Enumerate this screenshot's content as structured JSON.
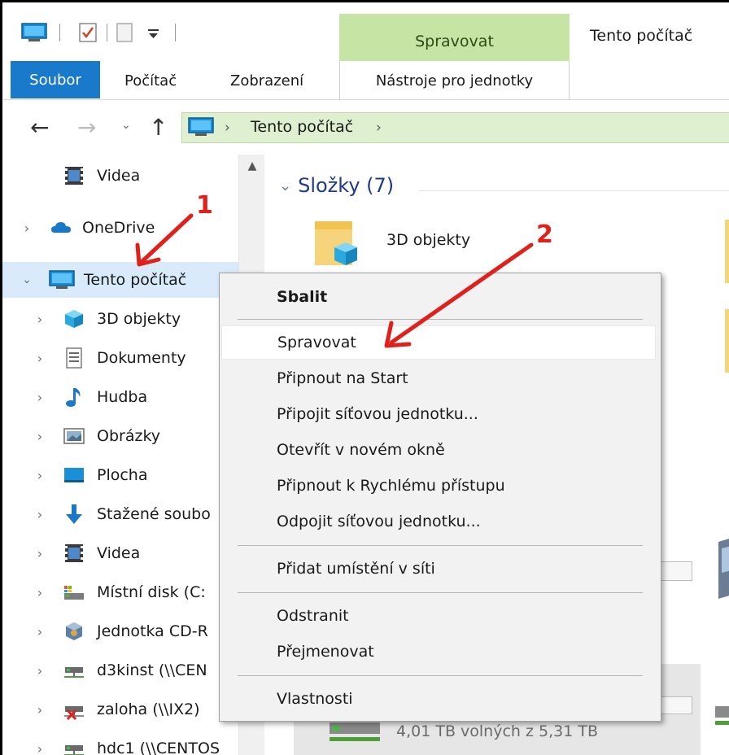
{
  "window": {
    "title": "Tento počítač"
  },
  "ribbon": {
    "context_group": "Spravovat",
    "tabs": [
      {
        "label": "Soubor"
      },
      {
        "label": "Počítač"
      },
      {
        "label": "Zobrazení"
      },
      {
        "label": "Nástroje pro jednotky"
      }
    ]
  },
  "toolbar": {
    "icons": [
      "computer-icon",
      "properties-check-icon",
      "new-folder-icon",
      "customize-dropdown-icon"
    ]
  },
  "address": {
    "back_icon": "arrow-left-icon",
    "forward_icon": "arrow-right-icon",
    "recent_icon": "chevron-down-icon",
    "up_icon": "arrow-up-icon",
    "path": "Tento počítač"
  },
  "navpane": {
    "items": [
      {
        "label": "Videa",
        "icon": "video-icon",
        "expandable": false
      },
      {
        "label": "OneDrive",
        "icon": "cloud-icon",
        "expandable": true
      },
      {
        "label": "Tento počítač",
        "icon": "computer-icon",
        "expandable": true,
        "expanded": true,
        "selected": true
      },
      {
        "label": "3D objekty",
        "icon": "cube-3d-icon",
        "expandable": true
      },
      {
        "label": "Dokumenty",
        "icon": "document-icon",
        "expandable": true
      },
      {
        "label": "Hudba",
        "icon": "music-note-icon",
        "expandable": true
      },
      {
        "label": "Obrázky",
        "icon": "picture-icon",
        "expandable": true
      },
      {
        "label": "Plocha",
        "icon": "desktop-icon",
        "expandable": true
      },
      {
        "label": "Stažené soubo",
        "icon": "download-arrow-icon",
        "expandable": true
      },
      {
        "label": "Videa",
        "icon": "video-icon",
        "expandable": true
      },
      {
        "label": "Místní disk (C:",
        "icon": "local-disk-icon",
        "expandable": true
      },
      {
        "label": "Jednotka CD-R",
        "icon": "cd-drive-icon",
        "expandable": true
      },
      {
        "label": "d3kinst (\\\\CEN",
        "icon": "network-drive-icon",
        "expandable": true
      },
      {
        "label": "zaloha (\\\\IX2)",
        "icon": "network-drive-disconnected-icon",
        "expandable": true
      },
      {
        "label": "hdc1 (\\\\CENTOS",
        "icon": "network-drive-icon",
        "expandable": true
      }
    ]
  },
  "content": {
    "group_header": "Složky (7)",
    "folders": [
      {
        "label": "3D objekty",
        "icon": "folder-3d-icon"
      }
    ],
    "drive_free_text": "4,01 TB volných z 5,31 TB",
    "drive_used_fraction": 0.245
  },
  "context_menu": {
    "items": [
      {
        "label": "Sbalit",
        "bold": true
      },
      {
        "label": "Spravovat",
        "highlighted": true
      },
      {
        "label": "Připnout na Start"
      },
      {
        "label": "Připojit síťovou jednotku..."
      },
      {
        "label": "Otevřít v novém okně"
      },
      {
        "label": "Připnout k Rychlému přístupu"
      },
      {
        "label": "Odpojit síťovou jednotku..."
      },
      {
        "label": "Přidat umístění v síti"
      },
      {
        "label": "Odstranit"
      },
      {
        "label": "Přejmenovat"
      },
      {
        "label": "Vlastnosti"
      }
    ]
  },
  "annotations": {
    "step1": "1",
    "step2": "2",
    "color": "#e0201b"
  }
}
